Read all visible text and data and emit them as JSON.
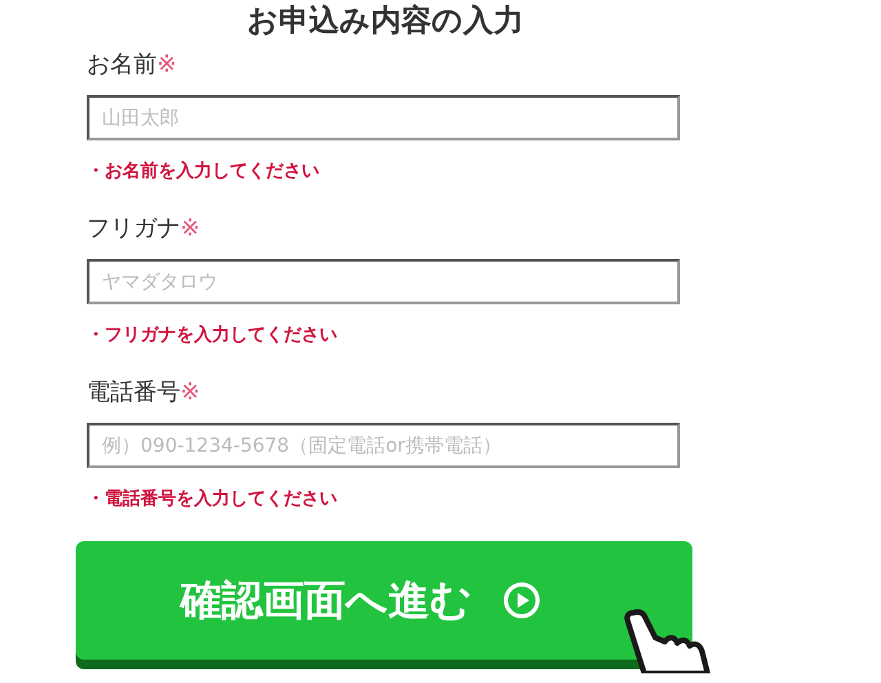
{
  "title": "お申込み内容の入力",
  "fields": [
    {
      "label": "お名前",
      "required_mark": "※",
      "placeholder": "山田太郎",
      "error": "・お名前を入力してください"
    },
    {
      "label": "フリガナ",
      "required_mark": "※",
      "placeholder": "ヤマダタロウ",
      "error": "・フリガナを入力してください"
    },
    {
      "label": "電話番号",
      "required_mark": "※",
      "placeholder": "例）090-1234-5678（固定電話or携帯電話）",
      "error": "・電話番号を入力してください"
    }
  ],
  "submit": {
    "label": "確認画面へ進む"
  }
}
